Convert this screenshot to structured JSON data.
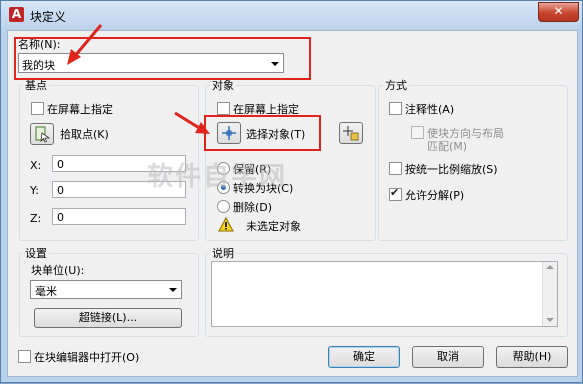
{
  "window": {
    "title": "块定义",
    "close_glyph": "✕"
  },
  "name": {
    "label": "名称(N):",
    "value": "我的块"
  },
  "base_point": {
    "label": "基点",
    "specify_on_screen": "在屏幕上指定",
    "pick_point": "拾取点(K)",
    "x_label": "X:",
    "x_value": "0",
    "y_label": "Y:",
    "y_value": "0",
    "z_label": "Z:",
    "z_value": "0"
  },
  "objects": {
    "label": "对象",
    "specify_on_screen": "在屏幕上指定",
    "select_objects": "选择对象(T)",
    "retain": "保留(R)",
    "convert_to_block": "转换为块(C)",
    "delete": "删除(D)",
    "status": "未选定对象"
  },
  "behavior": {
    "label": "方式",
    "annotative": "注释性(A)",
    "match_orientation_line1": "使块方向与布局",
    "match_orientation_line2": "匹配(M)",
    "scale_uniformly": "按统一比例缩放(S)",
    "allow_exploding": "允许分解(P)"
  },
  "settings": {
    "label": "设置",
    "block_unit_label": "块单位(U):",
    "block_unit_value": "毫米",
    "hyperlink": "超链接(L)..."
  },
  "description": {
    "label": "说明",
    "value": ""
  },
  "footer": {
    "open_in_editor": "在块编辑器中打开(O)",
    "ok": "确定",
    "cancel": "取消",
    "help": "帮助(H)"
  },
  "watermark": "软件自学网",
  "colors": {
    "annotation_red": "#e0241b",
    "title_bg": "#c8dbf0",
    "dialog_bg": "#f0f0f0"
  }
}
